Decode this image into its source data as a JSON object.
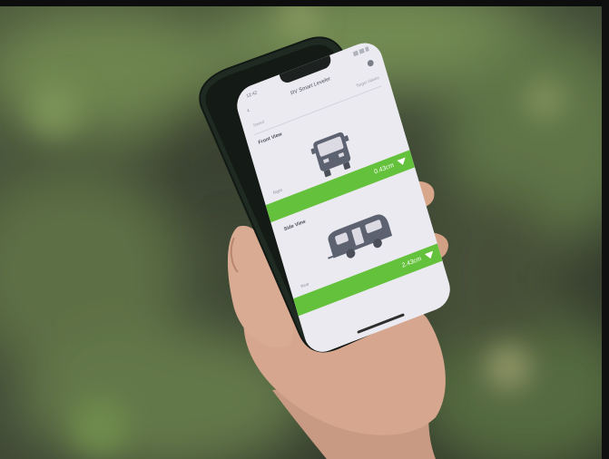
{
  "screen": {
    "status_time": "12:42",
    "app_title": "RV Smart Leveler",
    "tabs": [
      "Saved",
      "Target Values"
    ],
    "front_view": {
      "section_label": "Front View",
      "sub_label": "",
      "side_label": "Right",
      "level_value": "0.43cm"
    },
    "side_view": {
      "section_label": "Side View",
      "sub_label": "",
      "side_label": "Rear",
      "level_value": "2.43cm"
    }
  },
  "colors": {
    "accent_green": "#64c13b",
    "screen_bg": "#ebeaf0",
    "phone_case": "#1e2b22"
  },
  "icons": {
    "back": "chevron-left-icon",
    "settings": "gear-icon",
    "level_arrow": "arrow-down-icon",
    "front_vehicle": "motorhome-front-icon",
    "side_vehicle": "travel-trailer-side-icon"
  }
}
